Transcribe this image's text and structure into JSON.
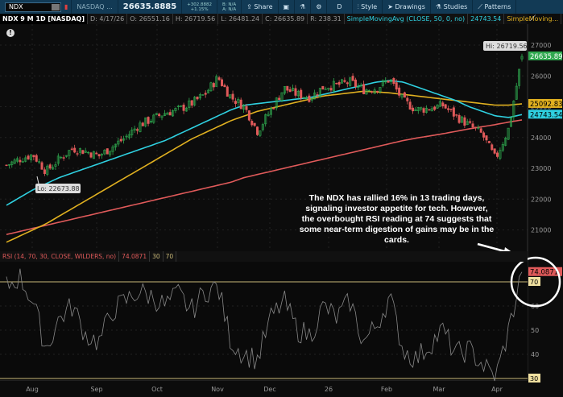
{
  "toolbar": {
    "symbol": "NDX",
    "exchange": "NASDAQ ...",
    "last": "26635.8885",
    "change": "+302.8882",
    "change_pct": "+1.15%",
    "bid": "B: N/A",
    "ask": "A: N/A",
    "share": "Share",
    "aggregation": "D",
    "style": "Style",
    "drawings": "Drawings",
    "studies": "Studies",
    "patterns": "Patterns"
  },
  "infobar": {
    "title": "NDX 9 M 1D [NASDAQ]",
    "date": "D: 4/17/26",
    "open": "O: 26551.16",
    "high": "H: 26719.56",
    "low": "L: 26481.24",
    "close": "C: 26635.89",
    "range": "R: 238.31",
    "sma50": "SimpleMovingAvg (CLOSE, 50, 0, no)",
    "sma50_value": "24743.54",
    "sma2": "SimpleMoving..."
  },
  "price_axis": {
    "ticks": [
      "27000",
      "26000",
      "25000",
      "24000",
      "23000",
      "22000",
      "21000"
    ],
    "last_label": "26635.89",
    "sma_yellow_label": "25092.83",
    "sma_cyan_label": "24743.54"
  },
  "markers": {
    "hi": "Hi: 26719.56",
    "lo": "Lo: 22673.88"
  },
  "annotation": "The NDX has rallied 16% in 13 trading days, signaling investor appetite for tech. However, the overbought RSI reading at 74 suggests that some near-term digestion of gains may be in the cards.",
  "rsi": {
    "header": "RSI (14, 70, 30, CLOSE, WILDERS, no)",
    "value": "74.0871",
    "ob": "70",
    "os": "30",
    "axis": [
      "60",
      "50",
      "40"
    ],
    "ob_label": "70",
    "os_label": "30",
    "value_label": "74.0871"
  },
  "x_axis": [
    "Aug",
    "Sep",
    "Oct",
    "Nov",
    "Dec",
    "26",
    "Feb",
    "Mar",
    "Apr"
  ],
  "colors": {
    "up": "#2fa84f",
    "down": "#e05a5a",
    "sma_cyan": "#2fd0e0",
    "sma_yellow": "#e0b020",
    "sma_red": "#e05a5a",
    "rsi_line": "#888888",
    "ob_line": "#c8b878"
  },
  "chart_data": {
    "type": "candlestick",
    "weekly_closes_approx": [
      23100,
      23300,
      23450,
      22900,
      23300,
      23650,
      23550,
      23400,
      23700,
      24000,
      24400,
      24600,
      24800,
      24900,
      25100,
      25400,
      25950,
      25300,
      25000,
      24200,
      24900,
      25600,
      25400,
      25300,
      25650,
      25700,
      25800,
      25550,
      25600,
      25900,
      25200,
      24900,
      24950,
      25050,
      24700,
      24400,
      24100,
      23300,
      24300,
      26636
    ],
    "sma_cyan_weekly": [
      21800,
      22050,
      22300,
      22500,
      22700,
      22850,
      23000,
      23150,
      23300,
      23450,
      23600,
      23750,
      23900,
      24100,
      24300,
      24500,
      24700,
      24900,
      25050,
      25100,
      25150,
      25200,
      25250,
      25300,
      25400,
      25500,
      25600,
      25700,
      25800,
      25850,
      25800,
      25650,
      25500,
      25350,
      25200,
      25000,
      24850,
      24700,
      24650,
      24743.54
    ],
    "sma_yellow_weekly": [
      20600,
      20800,
      21000,
      21200,
      21450,
      21700,
      21950,
      22200,
      22450,
      22700,
      22950,
      23200,
      23450,
      23700,
      23950,
      24150,
      24350,
      24550,
      24700,
      24850,
      24950,
      25050,
      25150,
      25250,
      25350,
      25400,
      25450,
      25500,
      25480,
      25450,
      25400,
      25350,
      25300,
      25250,
      25200,
      25150,
      25100,
      25050,
      25050,
      25092.83
    ],
    "sma_red_weekly": [
      20850,
      20950,
      21050,
      21150,
      21250,
      21350,
      21450,
      21550,
      21650,
      21750,
      21850,
      21950,
      22050,
      22150,
      22250,
      22350,
      22450,
      22550,
      22700,
      22800,
      22900,
      23000,
      23100,
      23200,
      23300,
      23400,
      23500,
      23600,
      23700,
      23800,
      23900,
      23980,
      24050,
      24120,
      24200,
      24280,
      24350,
      24420,
      24500,
      24570
    ],
    "rsi_weekly": [
      68,
      72,
      62,
      42,
      55,
      60,
      48,
      45,
      58,
      62,
      66,
      64,
      60,
      65,
      58,
      66,
      68,
      45,
      40,
      38,
      55,
      62,
      50,
      48,
      60,
      55,
      62,
      45,
      52,
      64,
      42,
      38,
      44,
      50,
      40,
      42,
      36,
      30,
      50,
      74.0871
    ],
    "ylim": [
      20500,
      27300
    ],
    "rsi_ylim": [
      28,
      78
    ]
  }
}
